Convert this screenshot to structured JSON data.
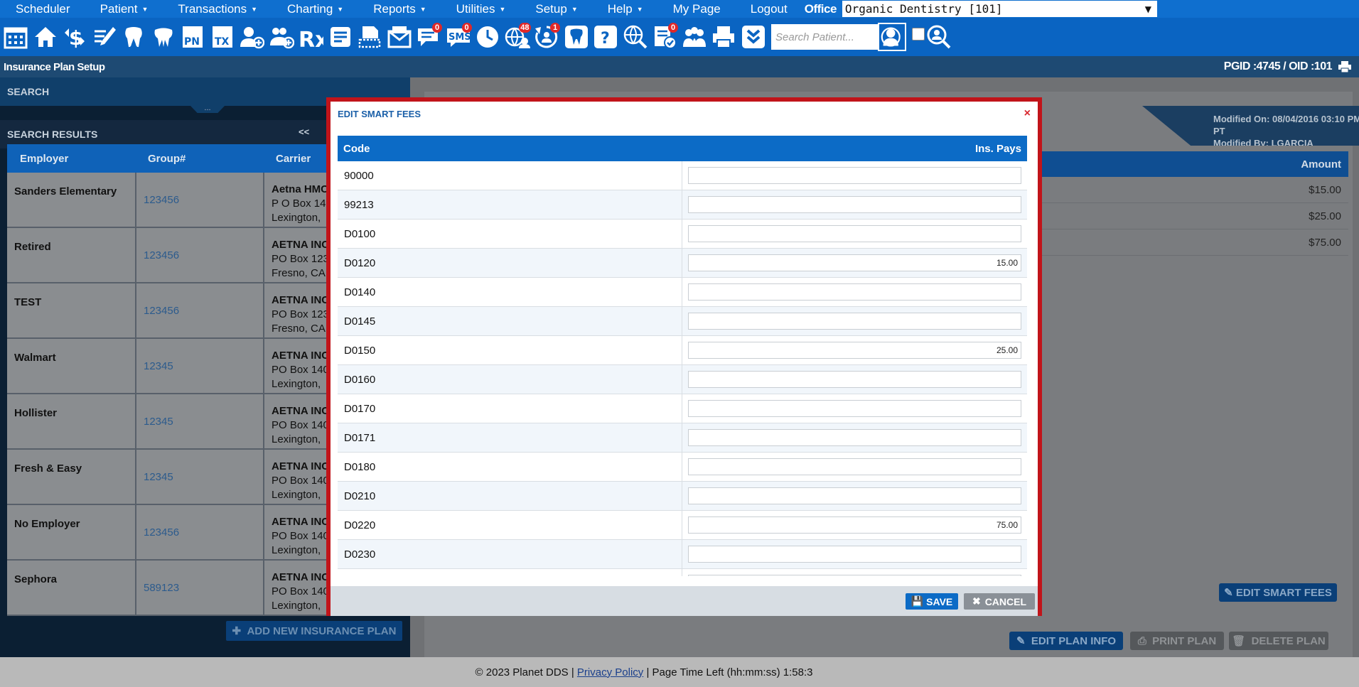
{
  "menu": {
    "items": [
      {
        "label": "Scheduler",
        "caret": false
      },
      {
        "label": "Patient",
        "caret": true
      },
      {
        "label": "Transactions",
        "caret": true
      },
      {
        "label": "Charting",
        "caret": true
      },
      {
        "label": "Reports",
        "caret": true
      },
      {
        "label": "Utilities",
        "caret": true
      },
      {
        "label": "Setup",
        "caret": true
      },
      {
        "label": "Help",
        "caret": true
      },
      {
        "label": "My Page",
        "caret": false
      },
      {
        "label": "Logout",
        "caret": false
      }
    ],
    "office_label": "Office",
    "office_value": "Organic Dentistry [101]"
  },
  "toolbar": {
    "badges": {
      "messages": "0",
      "sms": "0",
      "web": "48",
      "recall": "1",
      "forms": "0"
    },
    "sms_label": "SMS",
    "pn_label": "PN",
    "tx_label": "TX",
    "rx_label": "Rx",
    "search_placeholder": "Search Patient..."
  },
  "titlebar": {
    "title": "Insurance Plan Setup",
    "ids": "PGID :4745  /  OID :101"
  },
  "left": {
    "search_header": "SEARCH",
    "grip": "...",
    "results_header": "SEARCH RESULTS",
    "pager": "<<",
    "columns": [
      "Employer",
      "Group#",
      "Carrier"
    ],
    "rows": [
      {
        "employer": "Sanders Elementary",
        "group": "123456",
        "carrier": "Aetna HMC",
        "addr1": "P O Box 140",
        "addr2": "Lexington,"
      },
      {
        "employer": "Retired",
        "group": "123456",
        "carrier": "AETNA INC",
        "addr1": "PO Box 123",
        "addr2": "Fresno, CA"
      },
      {
        "employer": "TEST",
        "group": "123456",
        "carrier": "AETNA INC",
        "addr1": "PO Box 123",
        "addr2": "Fresno, CA"
      },
      {
        "employer": "Walmart",
        "group": "12345",
        "carrier": "AETNA INC",
        "addr1": "PO Box 140",
        "addr2": "Lexington,"
      },
      {
        "employer": "Hollister",
        "group": "12345",
        "carrier": "AETNA INC",
        "addr1": "PO Box 140",
        "addr2": "Lexington,"
      },
      {
        "employer": "Fresh & Easy",
        "group": "12345",
        "carrier": "AETNA INC",
        "addr1": "PO Box 140",
        "addr2": "Lexington,"
      },
      {
        "employer": "No Employer",
        "group": "123456",
        "carrier": "AETNA INC",
        "addr1": "PO Box 140",
        "addr2": "Lexington,"
      },
      {
        "employer": "Sephora",
        "group": "589123",
        "carrier": "AETNA INC",
        "addr1": "PO Box 140",
        "addr2": "Lexington,"
      }
    ],
    "add_button": "ADD NEW INSURANCE PLAN"
  },
  "right": {
    "modified_on": "Modified On: 08/04/2016 03:10 PM PT",
    "modified_by": "Modified By: LGARCIA",
    "amount_header": "Amount",
    "amounts": [
      "$15.00",
      "$25.00",
      "$75.00"
    ],
    "edit_smart_fees": "EDIT SMART FEES",
    "edit_plan_info": "EDIT PLAN INFO",
    "print_plan": "PRINT PLAN",
    "delete_plan": "DELETE PLAN"
  },
  "modal": {
    "title": "EDIT SMART FEES",
    "close": "×",
    "col_code": "Code",
    "col_ins": "Ins. Pays",
    "rows": [
      {
        "code": "90000",
        "value": ""
      },
      {
        "code": "99213",
        "value": ""
      },
      {
        "code": "D0100",
        "value": ""
      },
      {
        "code": "D0120",
        "value": "15.00"
      },
      {
        "code": "D0140",
        "value": ""
      },
      {
        "code": "D0145",
        "value": ""
      },
      {
        "code": "D0150",
        "value": "25.00"
      },
      {
        "code": "D0160",
        "value": ""
      },
      {
        "code": "D0170",
        "value": ""
      },
      {
        "code": "D0171",
        "value": ""
      },
      {
        "code": "D0180",
        "value": ""
      },
      {
        "code": "D0210",
        "value": ""
      },
      {
        "code": "D0220",
        "value": "75.00"
      },
      {
        "code": "D0230",
        "value": ""
      },
      {
        "code": "",
        "value": ""
      }
    ],
    "save": "SAVE",
    "cancel": "CANCEL"
  },
  "footer": {
    "copyright": "© 2023 Planet DDS |",
    "privacy": "Privacy Policy",
    "time_left": "|  Page Time Left (hh:mm:ss) 1:58:3"
  }
}
